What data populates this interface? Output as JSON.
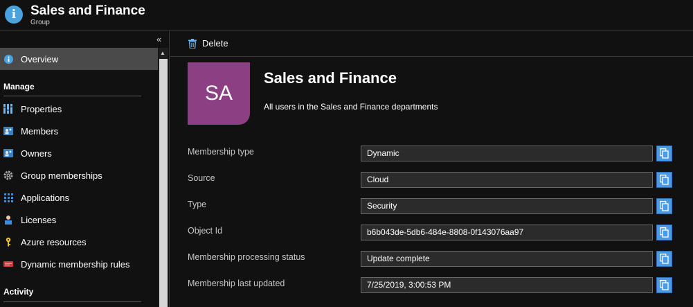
{
  "header": {
    "title": "Sales and Finance",
    "subtitle": "Group",
    "icon": "info-icon"
  },
  "sidebar": {
    "collapse_glyph": "«",
    "items": [
      {
        "label": "Overview",
        "icon": "info-icon",
        "active": true
      },
      {
        "label": "Properties",
        "icon": "properties-icon"
      },
      {
        "label": "Members",
        "icon": "members-icon"
      },
      {
        "label": "Owners",
        "icon": "owners-icon"
      },
      {
        "label": "Group memberships",
        "icon": "gear-icon"
      },
      {
        "label": "Applications",
        "icon": "grid-icon"
      },
      {
        "label": "Licenses",
        "icon": "license-icon"
      },
      {
        "label": "Azure resources",
        "icon": "key-icon"
      },
      {
        "label": "Dynamic membership rules",
        "icon": "rules-icon"
      }
    ],
    "sections": {
      "manage": "Manage",
      "activity": "Activity"
    }
  },
  "toolbar": {
    "delete_label": "Delete",
    "delete_icon": "trash-icon"
  },
  "group": {
    "initials": "SA",
    "avatar_color": "#8c3f82",
    "name": "Sales and Finance",
    "description": "All users in the Sales and Finance departments"
  },
  "properties": [
    {
      "label": "Membership type",
      "value": "Dynamic"
    },
    {
      "label": "Source",
      "value": "Cloud"
    },
    {
      "label": "Type",
      "value": "Security"
    },
    {
      "label": "Object Id",
      "value": "b6b043de-5db6-484e-8808-0f143076aa97"
    },
    {
      "label": "Membership processing status",
      "value": "Update complete"
    },
    {
      "label": "Membership last updated",
      "value": "7/25/2019, 3:00:53 PM"
    }
  ],
  "colors": {
    "background": "#111111",
    "accent": "#4a9be6",
    "active_nav": "#4a4a4a"
  }
}
